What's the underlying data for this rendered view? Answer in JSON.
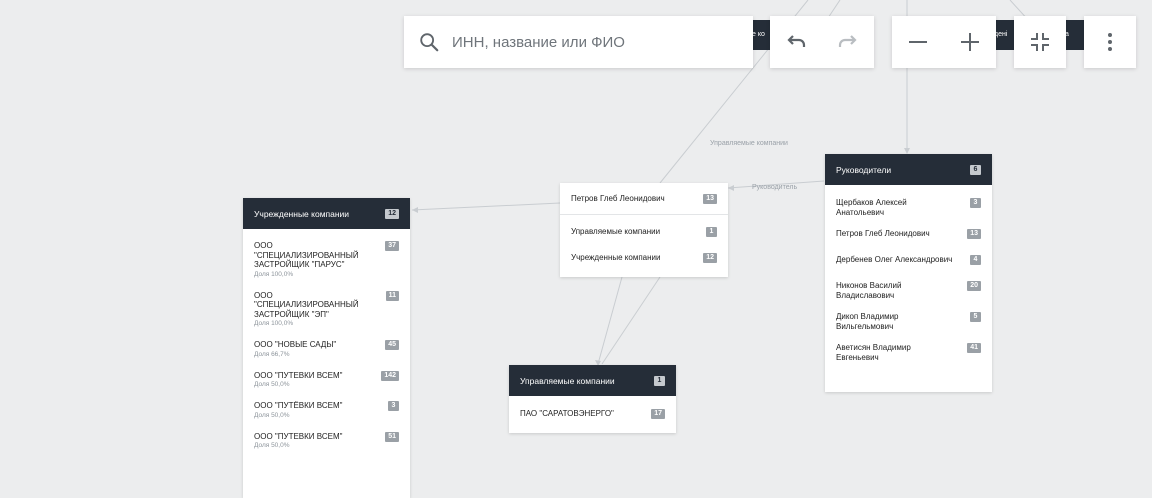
{
  "search": {
    "placeholder": "ИНН, название или ФИО"
  },
  "partial_labels": {
    "left": "е ко",
    "right": "дені",
    "right2": "а"
  },
  "edge_labels": {
    "managed": "Управляемые компании",
    "director": "Руководитель"
  },
  "founded": {
    "title": "Учрежденные компании",
    "count": "12",
    "items": [
      {
        "name": "ООО \"СПЕЦИАЛИЗИРОВАННЫЙ ЗАСТРОЙЩИК \"ПАРУС\"",
        "share": "Доля 100,0%",
        "count": "37"
      },
      {
        "name": "ООО \"СПЕЦИАЛИЗИРОВАННЫЙ ЗАСТРОЙЩИК \"ЭП\"",
        "share": "Доля 100,0%",
        "count": "11"
      },
      {
        "name": "ООО \"НОВЫЕ САДЫ\"",
        "share": "Доля 66,7%",
        "count": "45"
      },
      {
        "name": "ООО \"ПУТЕВКИ ВСЕМ\"",
        "share": "Доля 50,0%",
        "count": "142"
      },
      {
        "name": "ООО \"ПУТЁВКИ ВСЕМ\"",
        "share": "Доля 50,0%",
        "count": "3"
      },
      {
        "name": "ООО \"ПУТЕВКИ ВСЕМ\"",
        "share": "Доля 50,0%",
        "count": "51"
      }
    ]
  },
  "person": {
    "name": "Петров Глеб Леонидович",
    "count": "13",
    "rows": [
      {
        "label": "Управляемые компании",
        "count": "1"
      },
      {
        "label": "Учрежденные компании",
        "count": "12"
      }
    ]
  },
  "managed": {
    "title": "Управляемые компании",
    "count": "1",
    "items": [
      {
        "name": "ПАО \"САРАТОВЭНЕРГО\"",
        "count": "17"
      }
    ]
  },
  "directors": {
    "title": "Руководители",
    "count": "6",
    "items": [
      {
        "name": "Щербаков Алексей Анатольевич",
        "count": "3"
      },
      {
        "name": "Петров Глеб Леонидович",
        "count": "13"
      },
      {
        "name": "Дербенев Олег Александрович",
        "count": "4"
      },
      {
        "name": "Никонов Василий Владиславович",
        "count": "20"
      },
      {
        "name": "Дикоп Владимир Вильгельмович",
        "count": "5"
      },
      {
        "name": "Аветисян Владимир Евгеньевич",
        "count": "41"
      }
    ]
  }
}
